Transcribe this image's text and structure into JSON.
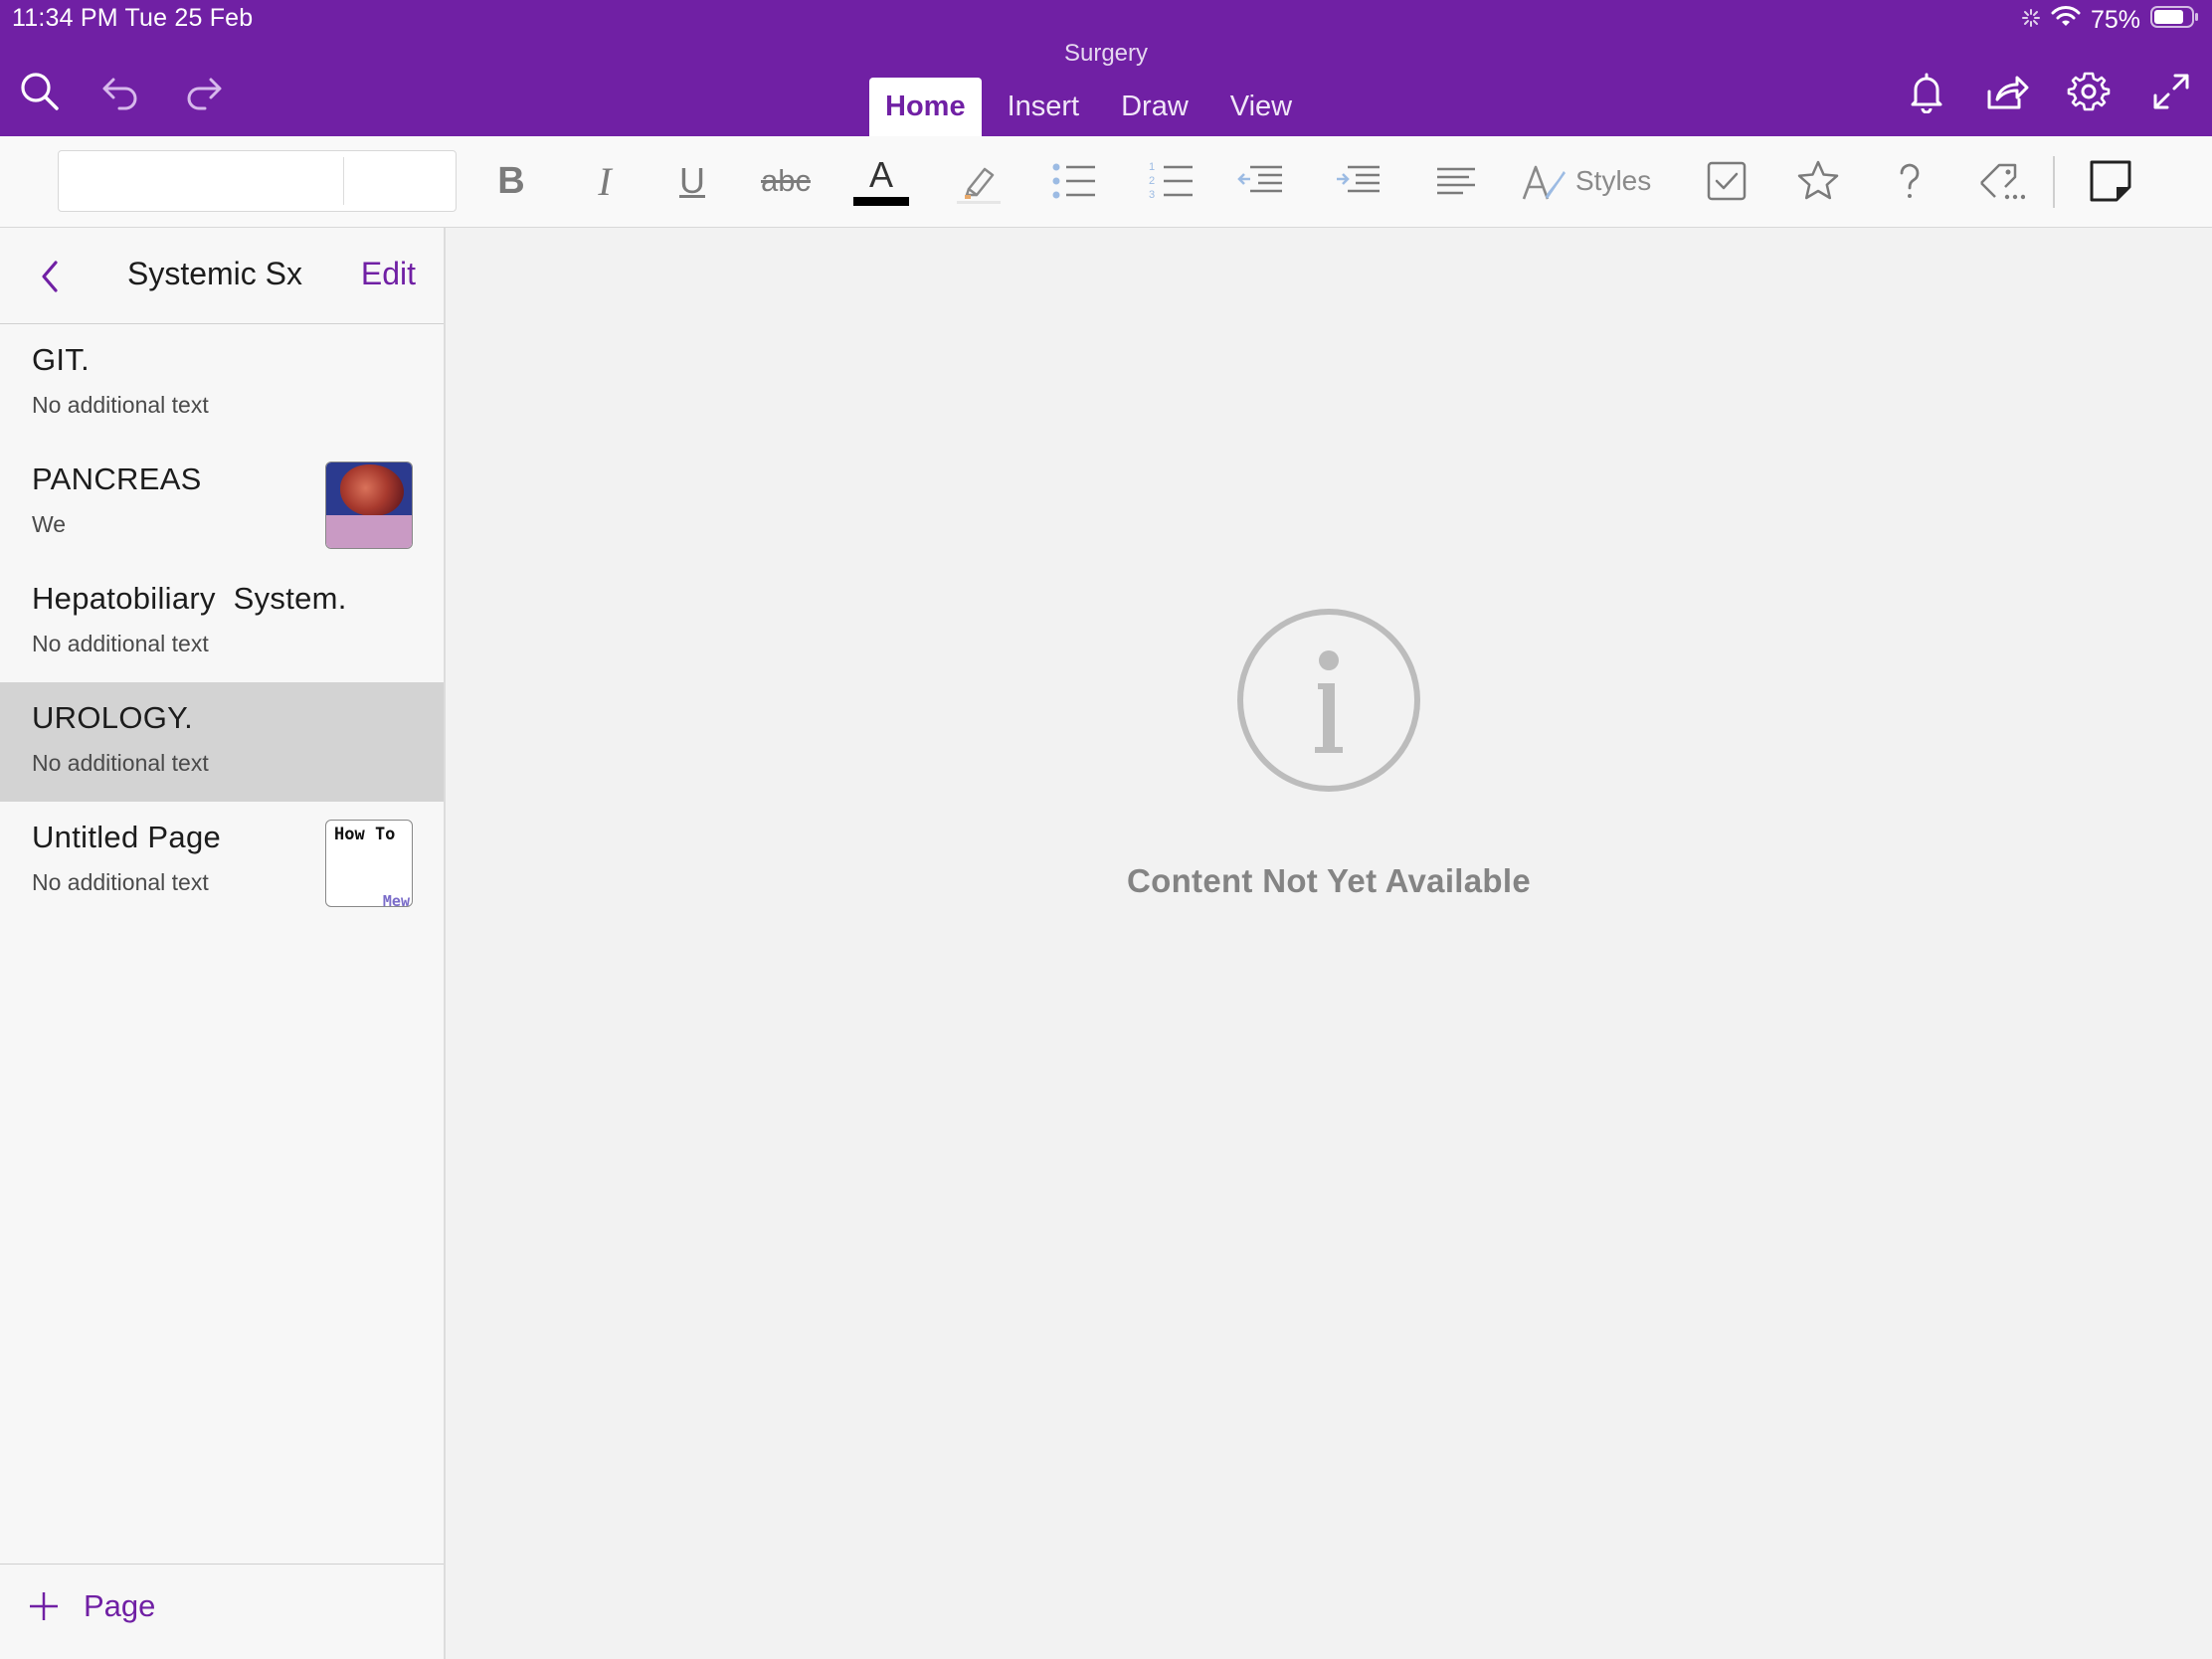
{
  "status_bar": {
    "time_date": "11:34 PM   Tue 25 Feb",
    "battery": "75%"
  },
  "header": {
    "title": "Surgery",
    "tabs": [
      {
        "label": "Home",
        "active": true
      },
      {
        "label": "Insert",
        "active": false
      },
      {
        "label": "Draw",
        "active": false
      },
      {
        "label": "View",
        "active": false
      }
    ],
    "left_icons": [
      "search-icon",
      "undo-icon",
      "redo-icon"
    ],
    "right_icons": [
      "bell-icon",
      "share-icon",
      "gear-icon",
      "expand-icon"
    ]
  },
  "ribbon": {
    "font_name": "",
    "font_size": "",
    "bold_glyph": "B",
    "italic_glyph": "I",
    "underline_glyph": "U",
    "strike_glyph": "abc",
    "font_color_glyph": "A",
    "font_color": "#000000",
    "styles_label": "Styles"
  },
  "sidebar": {
    "title": "Systemic Sx",
    "edit_label": "Edit",
    "pages": [
      {
        "title": "GIT.",
        "subtitle": "No additional text"
      },
      {
        "title": "PANCREAS",
        "subtitle": "We"
      },
      {
        "title": "Hepatobiliary  System.",
        "subtitle": "No additional text"
      },
      {
        "title": "UROLOGY.",
        "subtitle": "No additional text"
      },
      {
        "title": "Untitled Page",
        "subtitle": "No additional text",
        "thumb_text": "How To",
        "thumb_text2": "Mew"
      }
    ],
    "add_page_label": "Page"
  },
  "main": {
    "empty_message": "Content Not Yet Available"
  },
  "colors": {
    "accent": "#7020a4",
    "selected_row": "#d3d3d3"
  }
}
